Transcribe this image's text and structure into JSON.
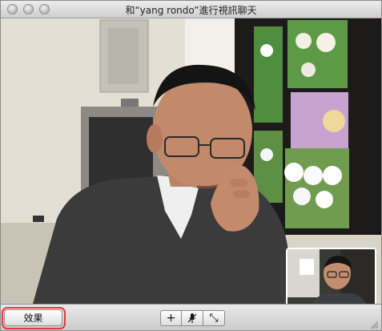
{
  "window": {
    "title": "和“yang rondo”進行視訊聊天"
  },
  "icons": {
    "close": "close-window-icon",
    "minimize": "minimize-window-icon",
    "zoom": "zoom-window-icon",
    "add": "plus-icon",
    "mute": "microphone-icon",
    "fullscreen": "fullscreen-arrows-icon",
    "resize": "resize-grip-icon"
  },
  "toolbar": {
    "effects_label": "效果",
    "add_symbol": "+",
    "fullscreen_symbol": "⤡"
  },
  "colors": {
    "highlight_ring": "#e03a3a"
  }
}
